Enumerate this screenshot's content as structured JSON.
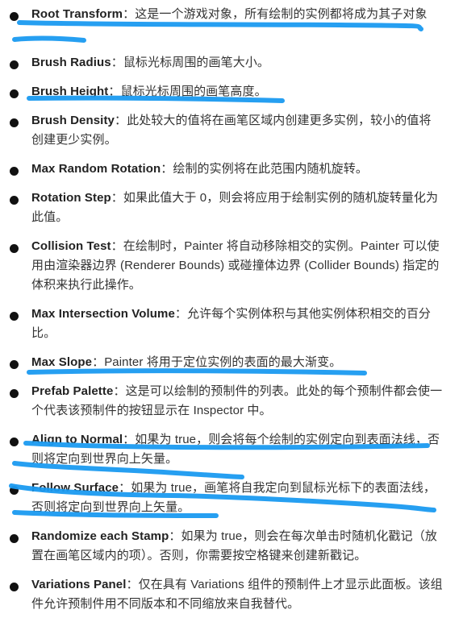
{
  "accent_color": "#1a9af0",
  "items": [
    {
      "term": "Root Transform",
      "sep": "：",
      "desc": "这是一个游戏对象，所有绘制的实例都将成为其子对象"
    },
    {
      "term": "Brush Radius",
      "sep": "：",
      "desc": "鼠标光标周围的画笔大小。"
    },
    {
      "term": "Brush Height",
      "sep": "：",
      "desc": "鼠标光标周围的画笔高度。"
    },
    {
      "term": "Brush Density",
      "sep": "：",
      "desc": "此处较大的值将在画笔区域内创建更多实例，较小的值将创建更少实例。"
    },
    {
      "term": "Max Random Rotation",
      "sep": "：",
      "desc": "绘制的实例将在此范围内随机旋转。"
    },
    {
      "term": "Rotation Step",
      "sep": "：",
      "desc": "如果此值大于 0，则会将应用于绘制实例的随机旋转量化为此值。"
    },
    {
      "term": "Collision Test",
      "sep": "：",
      "desc": "在绘制时，Painter 将自动移除相交的实例。Painter 可以使用由渲染器边界 (Renderer Bounds) 或碰撞体边界 (Collider Bounds) 指定的体积来执行此操作。"
    },
    {
      "term": "Max Intersection Volume",
      "sep": "：",
      "desc": "允许每个实例体积与其他实例体积相交的百分比。"
    },
    {
      "term": "Max Slope",
      "sep": "：",
      "desc": "Painter 将用于定位实例的表面的最大渐变。"
    },
    {
      "term": "Prefab Palette",
      "sep": "：",
      "desc": "这是可以绘制的预制件的列表。此处的每个预制件都会使一个代表该预制件的按钮显示在 Inspector 中。"
    },
    {
      "term": "Align to Normal",
      "sep": "：",
      "desc": "如果为 true，则会将每个绘制的实例定向到表面法线，否则将定向到世界向上矢量。"
    },
    {
      "term": "Follow Surface",
      "sep": "：",
      "desc": "如果为 true，画笔将自我定向到鼠标光标下的表面法线，否则将定向到世界向上矢量。"
    },
    {
      "term": "Randomize each Stamp",
      "sep": "：",
      "desc": "如果为 true，则会在每次单击时随机化戳记（放置在画笔区域内的项）。否则，你需要按空格键来创建新戳记。"
    },
    {
      "term": "Variations Panel",
      "sep": "：",
      "desc": "仅在具有 Variations 组件的预制件上才显示此面板。该组件允许预制件用不同版本和不同缩放来自我替代。"
    }
  ]
}
